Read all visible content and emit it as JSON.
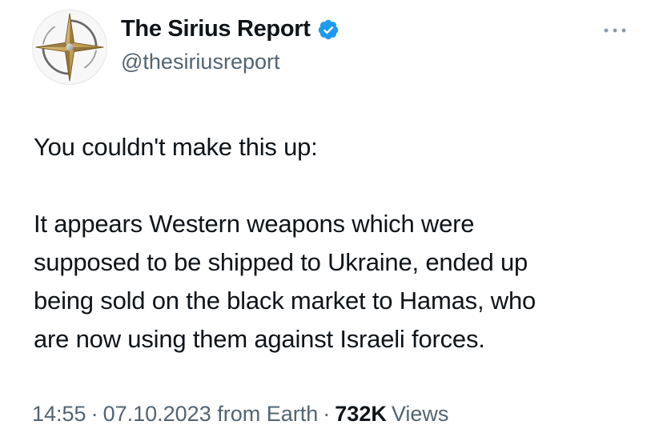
{
  "author": {
    "display_name": "The Sirius Report",
    "handle": "@thesiriusreport",
    "verified": true,
    "avatar_icon": "compass-star-logo-icon",
    "verified_color": "#1d9bf0"
  },
  "tweet": {
    "lines_para1": [
      "You couldn't make this up:"
    ],
    "lines_para2": [
      "It appears Western weapons which were",
      "supposed to be shipped to Ukraine, ended up",
      "being sold on the black market to Hamas, who",
      "are now using them against Israeli forces."
    ]
  },
  "meta": {
    "time": "14:55",
    "date": "07.10.2023",
    "source": "from Earth",
    "separator": "·",
    "views_count": "732K",
    "views_label": "Views"
  },
  "more_icon": "more-horizontal-icon"
}
